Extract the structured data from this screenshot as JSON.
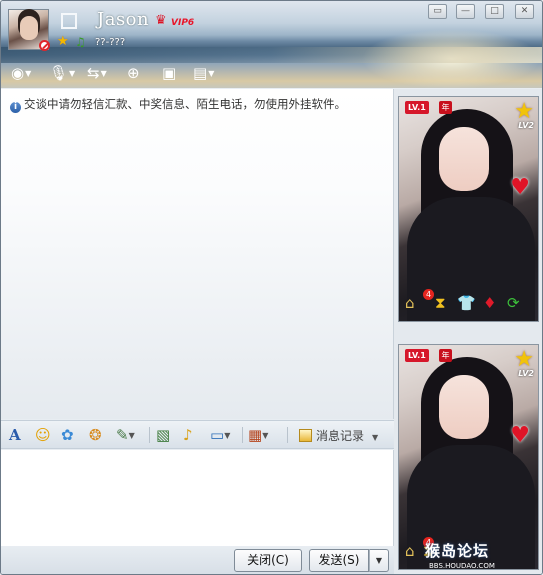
{
  "header": {
    "contact_name": "Jason",
    "vip_label": "VIP6",
    "signature": "??-???",
    "window_controls": [
      "restore-icon",
      "minimize-icon",
      "maximize-icon",
      "close-icon"
    ]
  },
  "toolbar": {
    "items": [
      "video-call-icon",
      "voice-call-icon",
      "file-transfer-icon",
      "add-contact-icon",
      "screen-share-icon",
      "application-icon"
    ]
  },
  "chat": {
    "notice": "交谈中请勿轻信汇款、中奖信息、陌生电话，勿使用外挂软件。"
  },
  "format_bar": {
    "history_label": "消息记录"
  },
  "buttons": {
    "close_label": "关闭(C)",
    "send_label": "发送(S)"
  },
  "show_panel": {
    "level_badge": "LV.1",
    "year_badge": "年",
    "star_level": "LV2",
    "house_count": "4",
    "watermark": "猴岛论坛",
    "watermark_url": "BBS.HOUDAO.COM"
  },
  "colors": {
    "accent": "#2b5fa8",
    "vip_red": "#e8162a",
    "star_gold": "#f1c30a"
  }
}
